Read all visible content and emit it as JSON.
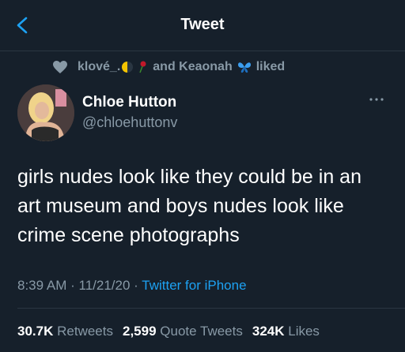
{
  "header": {
    "title": "Tweet"
  },
  "social_context": {
    "liker": "klové_.",
    "and_text": "and Keaonah",
    "liked_text": "liked"
  },
  "author": {
    "name": "Chloe Hutton",
    "handle": "@chloehuttonv"
  },
  "tweet": {
    "text": "girls nudes look like they could be in an art museum and boys nudes look like crime scene photographs"
  },
  "meta": {
    "time": "8:39 AM",
    "sep1": "·",
    "date": "11/21/20",
    "sep2": "·",
    "source": "Twitter for iPhone"
  },
  "stats": {
    "retweets_count": "30.7K",
    "retweets_label": "Retweets",
    "quotes_count": "2,599",
    "quotes_label": "Quote Tweets",
    "likes_count": "324K",
    "likes_label": "Likes"
  },
  "colors": {
    "background": "#16202b",
    "accent": "#1da1f2",
    "muted": "#8899a6"
  }
}
